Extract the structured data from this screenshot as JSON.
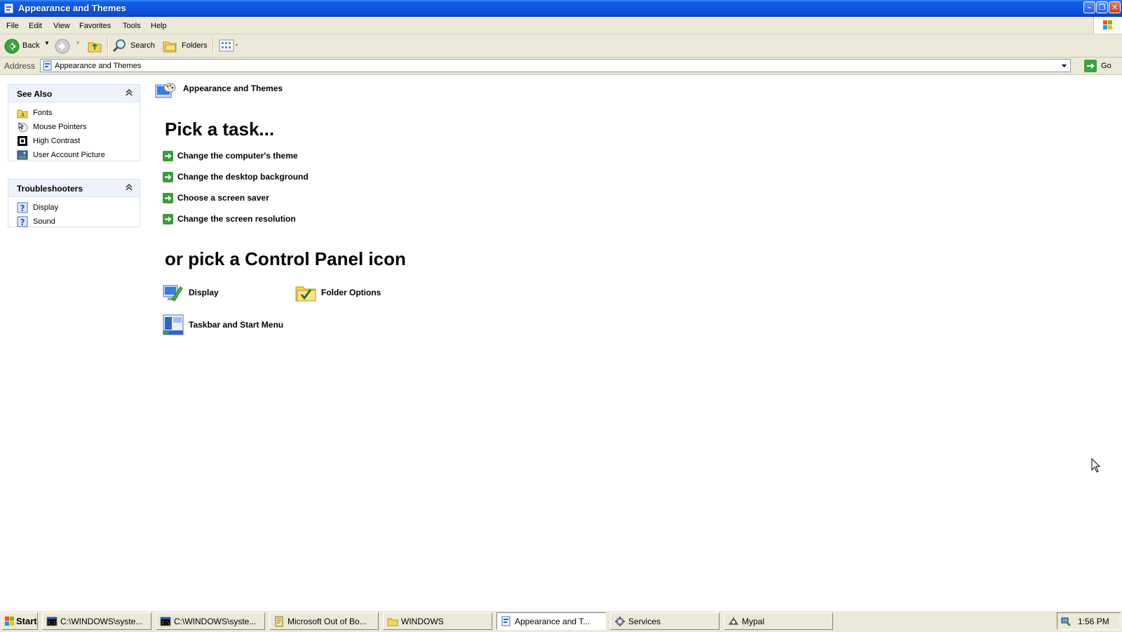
{
  "window": {
    "title": "Appearance and Themes"
  },
  "menu": [
    "File",
    "Edit",
    "View",
    "Favorites",
    "Tools",
    "Help"
  ],
  "toolbar": {
    "back": "Back",
    "search": "Search",
    "folders": "Folders"
  },
  "address": {
    "label": "Address",
    "value": "Appearance and Themes",
    "go": "Go"
  },
  "sidebar": {
    "see_also": {
      "title": "See Also",
      "items": [
        "Fonts",
        "Mouse Pointers",
        "High Contrast",
        "User Account Picture"
      ]
    },
    "troubleshooters": {
      "title": "Troubleshooters",
      "items": [
        "Display",
        "Sound"
      ]
    }
  },
  "main": {
    "category_title": "Appearance and Themes",
    "task_heading": "Pick a task...",
    "tasks": [
      "Change the computer's theme",
      "Change the desktop background",
      "Choose a screen saver",
      "Change the screen resolution"
    ],
    "icon_heading": "or pick a Control Panel icon",
    "icons": [
      "Display",
      "Folder Options",
      "Taskbar and Start Menu"
    ]
  },
  "taskbar": {
    "start": "Start",
    "buttons": [
      "C:\\WINDOWS\\syste...",
      "C:\\WINDOWS\\syste...",
      "Microsoft Out of Bo...",
      "WINDOWS",
      "Appearance and T...",
      "Services",
      "Mypal"
    ],
    "clock": "1:56 PM"
  },
  "colors": {
    "titlebar": "#0c55e0",
    "chrome": "#ece9d8",
    "panel_border": "#d6dff7",
    "task_arrow": "#3a9c3a"
  }
}
